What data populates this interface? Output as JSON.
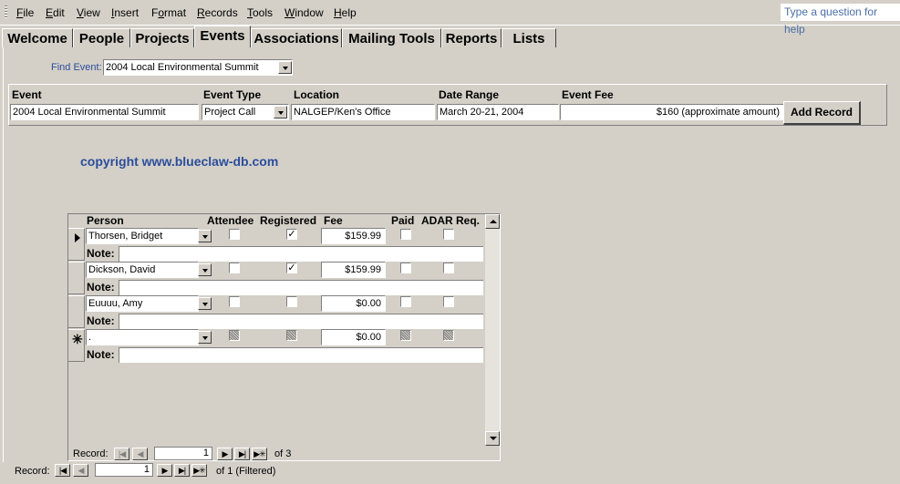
{
  "menu": {
    "items": [
      {
        "label": "File",
        "accel": "F",
        "rest": "ile"
      },
      {
        "label": "Edit",
        "accel": "E",
        "rest": "dit"
      },
      {
        "label": "View",
        "accel": "V",
        "rest": "iew"
      },
      {
        "label": "Insert",
        "accel": "I",
        "rest": "nsert"
      },
      {
        "label": "Format",
        "accel": "o",
        "pre": "F",
        "rest": "rmat"
      },
      {
        "label": "Records",
        "accel": "R",
        "rest": "ecords"
      },
      {
        "label": "Tools",
        "accel": "T",
        "rest": "ools"
      },
      {
        "label": "Window",
        "accel": "W",
        "rest": "indow"
      },
      {
        "label": "Help",
        "accel": "H",
        "rest": "elp"
      }
    ],
    "help_placeholder": "Type a question for help"
  },
  "tabs": [
    "Welcome",
    "People",
    "Projects",
    "Events",
    "Associations",
    "Mailing Tools",
    "Reports",
    "Lists"
  ],
  "active_tab": "Events",
  "find_event": {
    "label": "Find Event:",
    "value": "2004 Local Environmental Summit"
  },
  "event_headers": {
    "event": "Event",
    "type": "Event Type",
    "location": "Location",
    "date_range": "Date Range",
    "fee": "Event Fee"
  },
  "event": {
    "name": "2004 Local Environmental Summit",
    "type": "Project Call",
    "location": "NALGEP/Ken's Office",
    "date_range": "March 20-21, 2004",
    "fee": "$160 (approximate amount)"
  },
  "add_record_label": "Add Record",
  "copyright": "copyright www.blueclaw-db.com",
  "subform": {
    "headers": {
      "person": "Person",
      "attendee": "Attendee",
      "registered": "Registered",
      "fee": "Fee",
      "paid": "Paid",
      "adar": "ADAR Req."
    },
    "note_label": "Note:",
    "rows": [
      {
        "person": "Thorsen, Bridget",
        "attendee": false,
        "registered": true,
        "fee": "$159.99",
        "paid": false,
        "adar": false,
        "note": "",
        "current": true
      },
      {
        "person": "Dickson, David",
        "attendee": false,
        "registered": true,
        "fee": "$159.99",
        "paid": false,
        "adar": false,
        "note": "",
        "current": false
      },
      {
        "person": "Euuuu, Amy",
        "attendee": false,
        "registered": false,
        "fee": "$0.00",
        "paid": false,
        "adar": false,
        "note": "",
        "current": false
      },
      {
        "person": ".",
        "attendee": null,
        "registered": null,
        "fee": "$0.00",
        "paid": null,
        "adar": null,
        "note": "",
        "new_record": true
      }
    ],
    "nav": {
      "label": "Record:",
      "current": "1",
      "of_text": "of 3"
    }
  },
  "main_nav": {
    "label": "Record:",
    "current": "1",
    "of_text": "of 1 (Filtered)"
  }
}
